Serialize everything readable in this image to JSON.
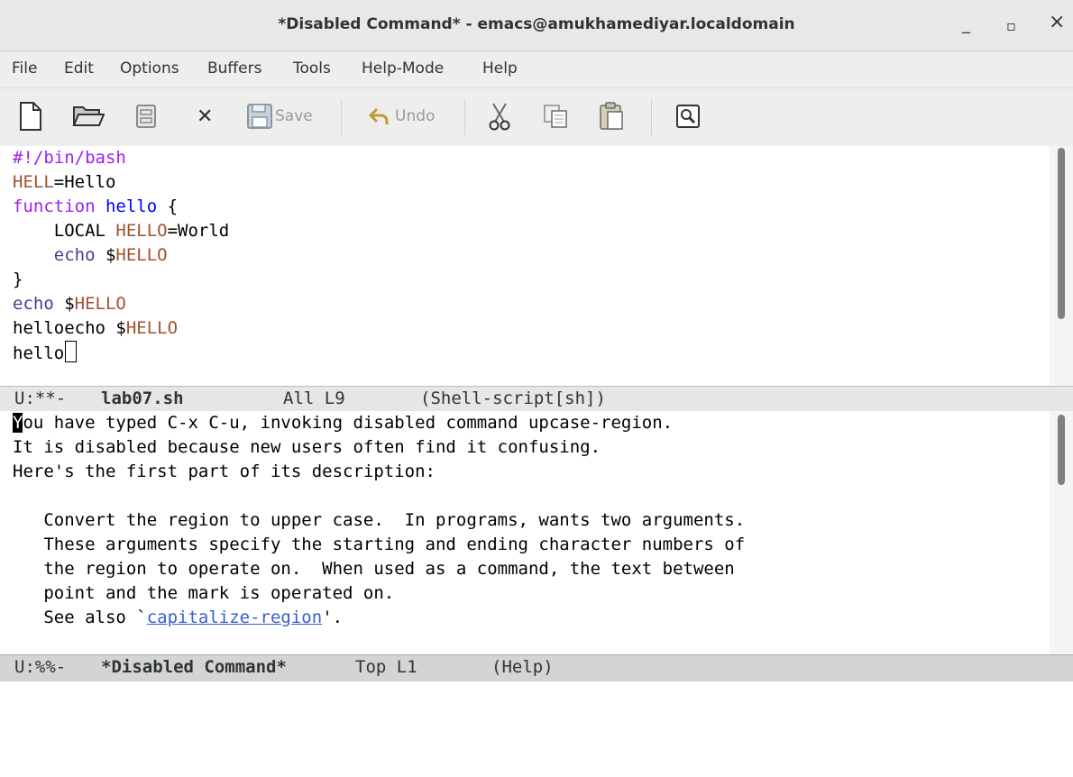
{
  "window": {
    "title": "*Disabled Command* - emacs@amukhamediyar.localdomain",
    "minimize": "_",
    "maximize": "▫",
    "close": "×"
  },
  "menubar": {
    "items": [
      "File",
      "Edit",
      "Options",
      "Buffers",
      "Tools",
      "Help-Mode",
      "Help"
    ]
  },
  "toolbar": {
    "save_label": "Save",
    "undo_label": "Undo"
  },
  "editor": {
    "lines": [
      [
        {
          "t": "#!/bin/bash",
          "c": "kw"
        }
      ],
      [
        {
          "t": "HELL",
          "c": "var"
        },
        {
          "t": "=Hello",
          "c": ""
        }
      ],
      [
        {
          "t": "function",
          "c": "kw"
        },
        {
          "t": " ",
          "c": ""
        },
        {
          "t": "hello",
          "c": "fn"
        },
        {
          "t": " {",
          "c": ""
        }
      ],
      [
        {
          "t": "    LOCAL ",
          "c": ""
        },
        {
          "t": "HELLO",
          "c": "var"
        },
        {
          "t": "=World",
          "c": ""
        }
      ],
      [
        {
          "t": "    ",
          "c": ""
        },
        {
          "t": "echo",
          "c": "bi"
        },
        {
          "t": " $",
          "c": ""
        },
        {
          "t": "HELLO",
          "c": "var"
        }
      ],
      [
        {
          "t": "}",
          "c": ""
        }
      ],
      [
        {
          "t": "echo",
          "c": "bi"
        },
        {
          "t": " $",
          "c": ""
        },
        {
          "t": "HELLO",
          "c": "var"
        }
      ],
      [
        {
          "t": "helloecho $",
          "c": ""
        },
        {
          "t": "HELLO",
          "c": "var"
        }
      ],
      [
        {
          "t": "hello",
          "c": ""
        },
        {
          "t": "",
          "c": "cursor"
        }
      ]
    ]
  },
  "modeline_top": {
    "status": "U:**-",
    "buffer": "lab07.sh",
    "position": "All L9",
    "mode": "(Shell-script[sh])"
  },
  "help": {
    "cursor_char": "Y",
    "line1_rest": "ou have typed C-x C-u, invoking disabled command upcase-region.",
    "line2": "It is disabled because new users often find it confusing.",
    "line3": "Here's the first part of its description:",
    "line5": "   Convert the region to upper case.  In programs, wants two arguments.",
    "line6": "   These arguments specify the starting and ending character numbers of",
    "line7": "   the region to operate on.  When used as a command, the text between",
    "line8": "   point and the mark is operated on.",
    "line9_prefix": "   See also `",
    "line9_link": "capitalize-region",
    "line9_suffix": "'."
  },
  "modeline_bottom": {
    "status": "U:%%-",
    "buffer": "*Disabled Command*",
    "position": "Top L1",
    "mode": "(Help)"
  }
}
